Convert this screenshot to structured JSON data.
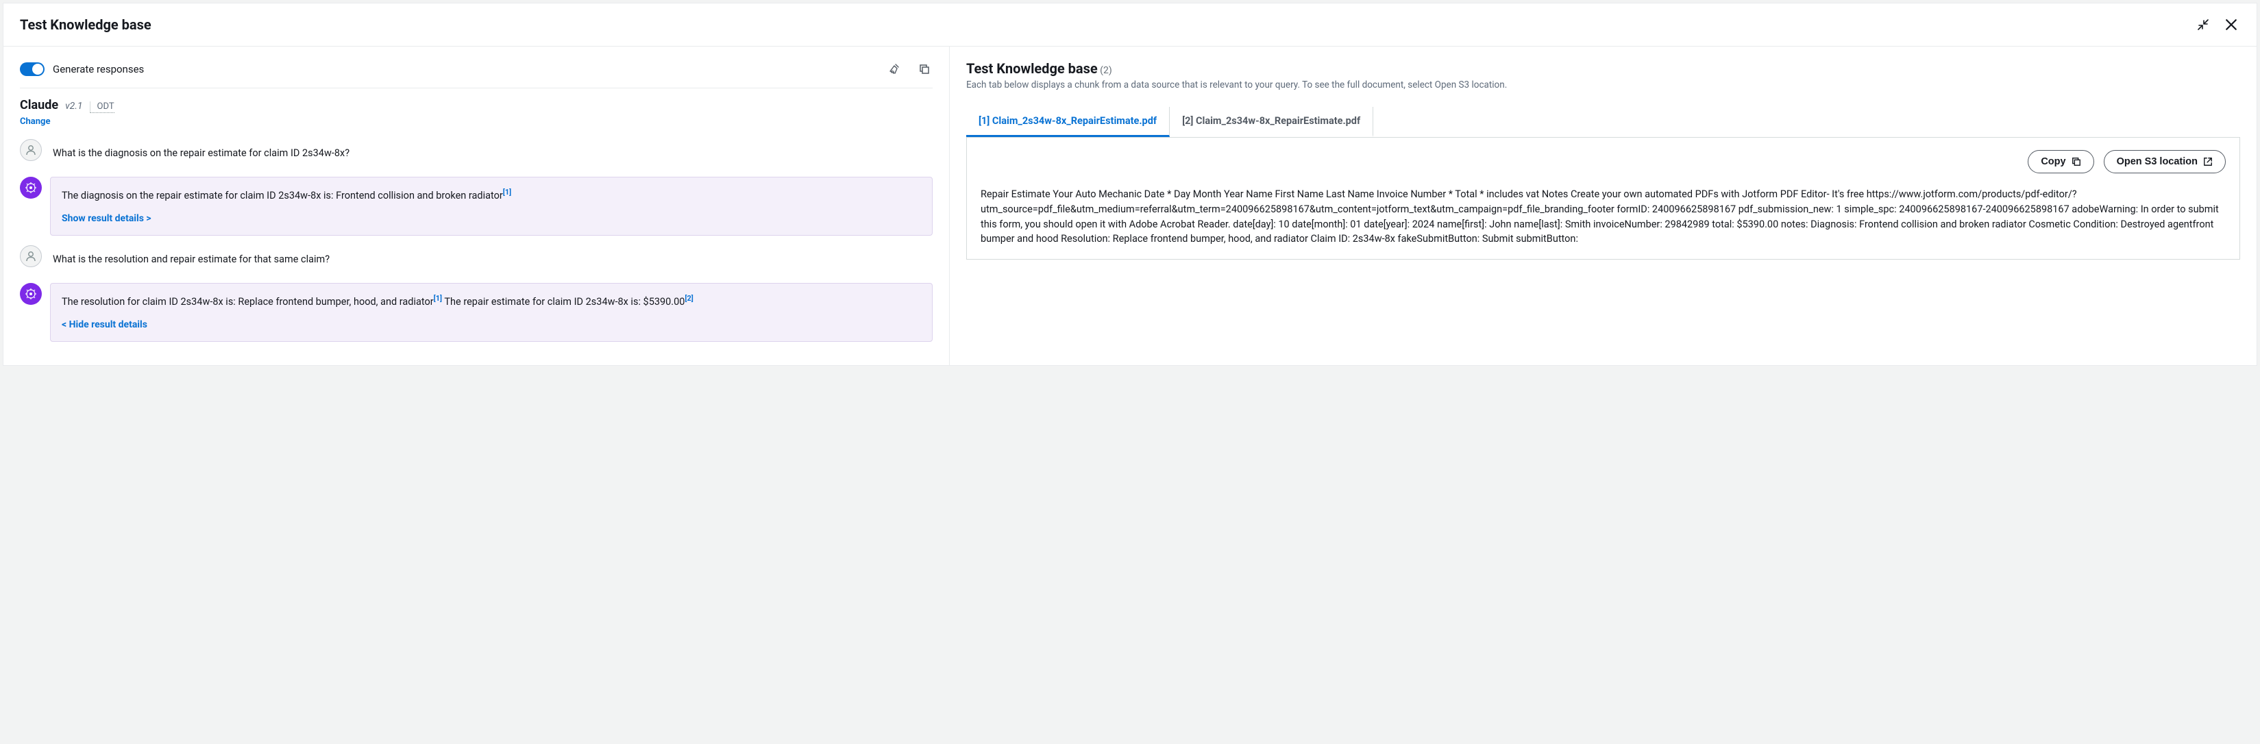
{
  "titlebar": {
    "title": "Test Knowledge base"
  },
  "left": {
    "toggle_label": "Generate responses",
    "model_name": "Claude",
    "model_version": "v2.1",
    "model_odt": "ODT",
    "change_label": "Change",
    "chat": [
      {
        "role": "user",
        "text": "What is the diagnosis on the repair estimate for claim ID 2s34w-8x?"
      },
      {
        "role": "ai",
        "text": "The diagnosis on the repair estimate for claim ID 2s34w-8x is: Frontend collision and broken radiator",
        "citations": [
          "[1]"
        ],
        "details_label": "Show result details >"
      },
      {
        "role": "user",
        "text": "What is the resolution and repair estimate for that same claim?"
      },
      {
        "role": "ai",
        "text_line1": "The resolution for claim ID 2s34w-8x is: Replace frontend bumper, hood, and radiator",
        "cit1": "[1]",
        "text_line2": "The repair estimate for claim ID 2s34w-8x is: $5390.00",
        "cit2": "[2]",
        "details_label": "< Hide result details"
      }
    ]
  },
  "right": {
    "header": "Test Knowledge base",
    "count": "(2)",
    "desc": "Each tab below displays a chunk from a data source that is relevant to your query. To see the full document, select Open S3 location.",
    "tabs": [
      {
        "label": "[1] Claim_2s34w-8x_RepairEstimate.pdf",
        "active": true
      },
      {
        "label": "[2] Claim_2s34w-8x_RepairEstimate.pdf",
        "active": false
      }
    ],
    "copy_label": "Copy",
    "open_s3_label": "Open S3 location",
    "chunk_text": "Repair Estimate Your Auto Mechanic Date * Day Month Year Name First Name Last Name Invoice Number * Total * includes vat Notes Create your own automated PDFs with Jotform PDF Editor- It's free https://www.jotform.com/products/pdf-editor/?utm_source=pdf_file&utm_medium=referral&utm_term=240096625898167&utm_content=jotform_text&utm_campaign=pdf_file_branding_footer formID: 240096625898167 pdf_submission_new: 1 simple_spc: 240096625898167-240096625898167 adobeWarning: In order to submit this form, you should open it with Adobe Acrobat Reader. date[day]: 10 date[month]: 01 date[year]: 2024 name[first]: John name[last]: Smith invoiceNumber: 29842989 total: $5390.00 notes: Diagnosis: Frontend collision and broken radiator Cosmetic Condition: Destroyed agentfront bumper and hood Resolution: Replace frontend bumper, hood, and radiator Claim ID: 2s34w-8x fakeSubmitButton: Submit submitButton:"
  }
}
